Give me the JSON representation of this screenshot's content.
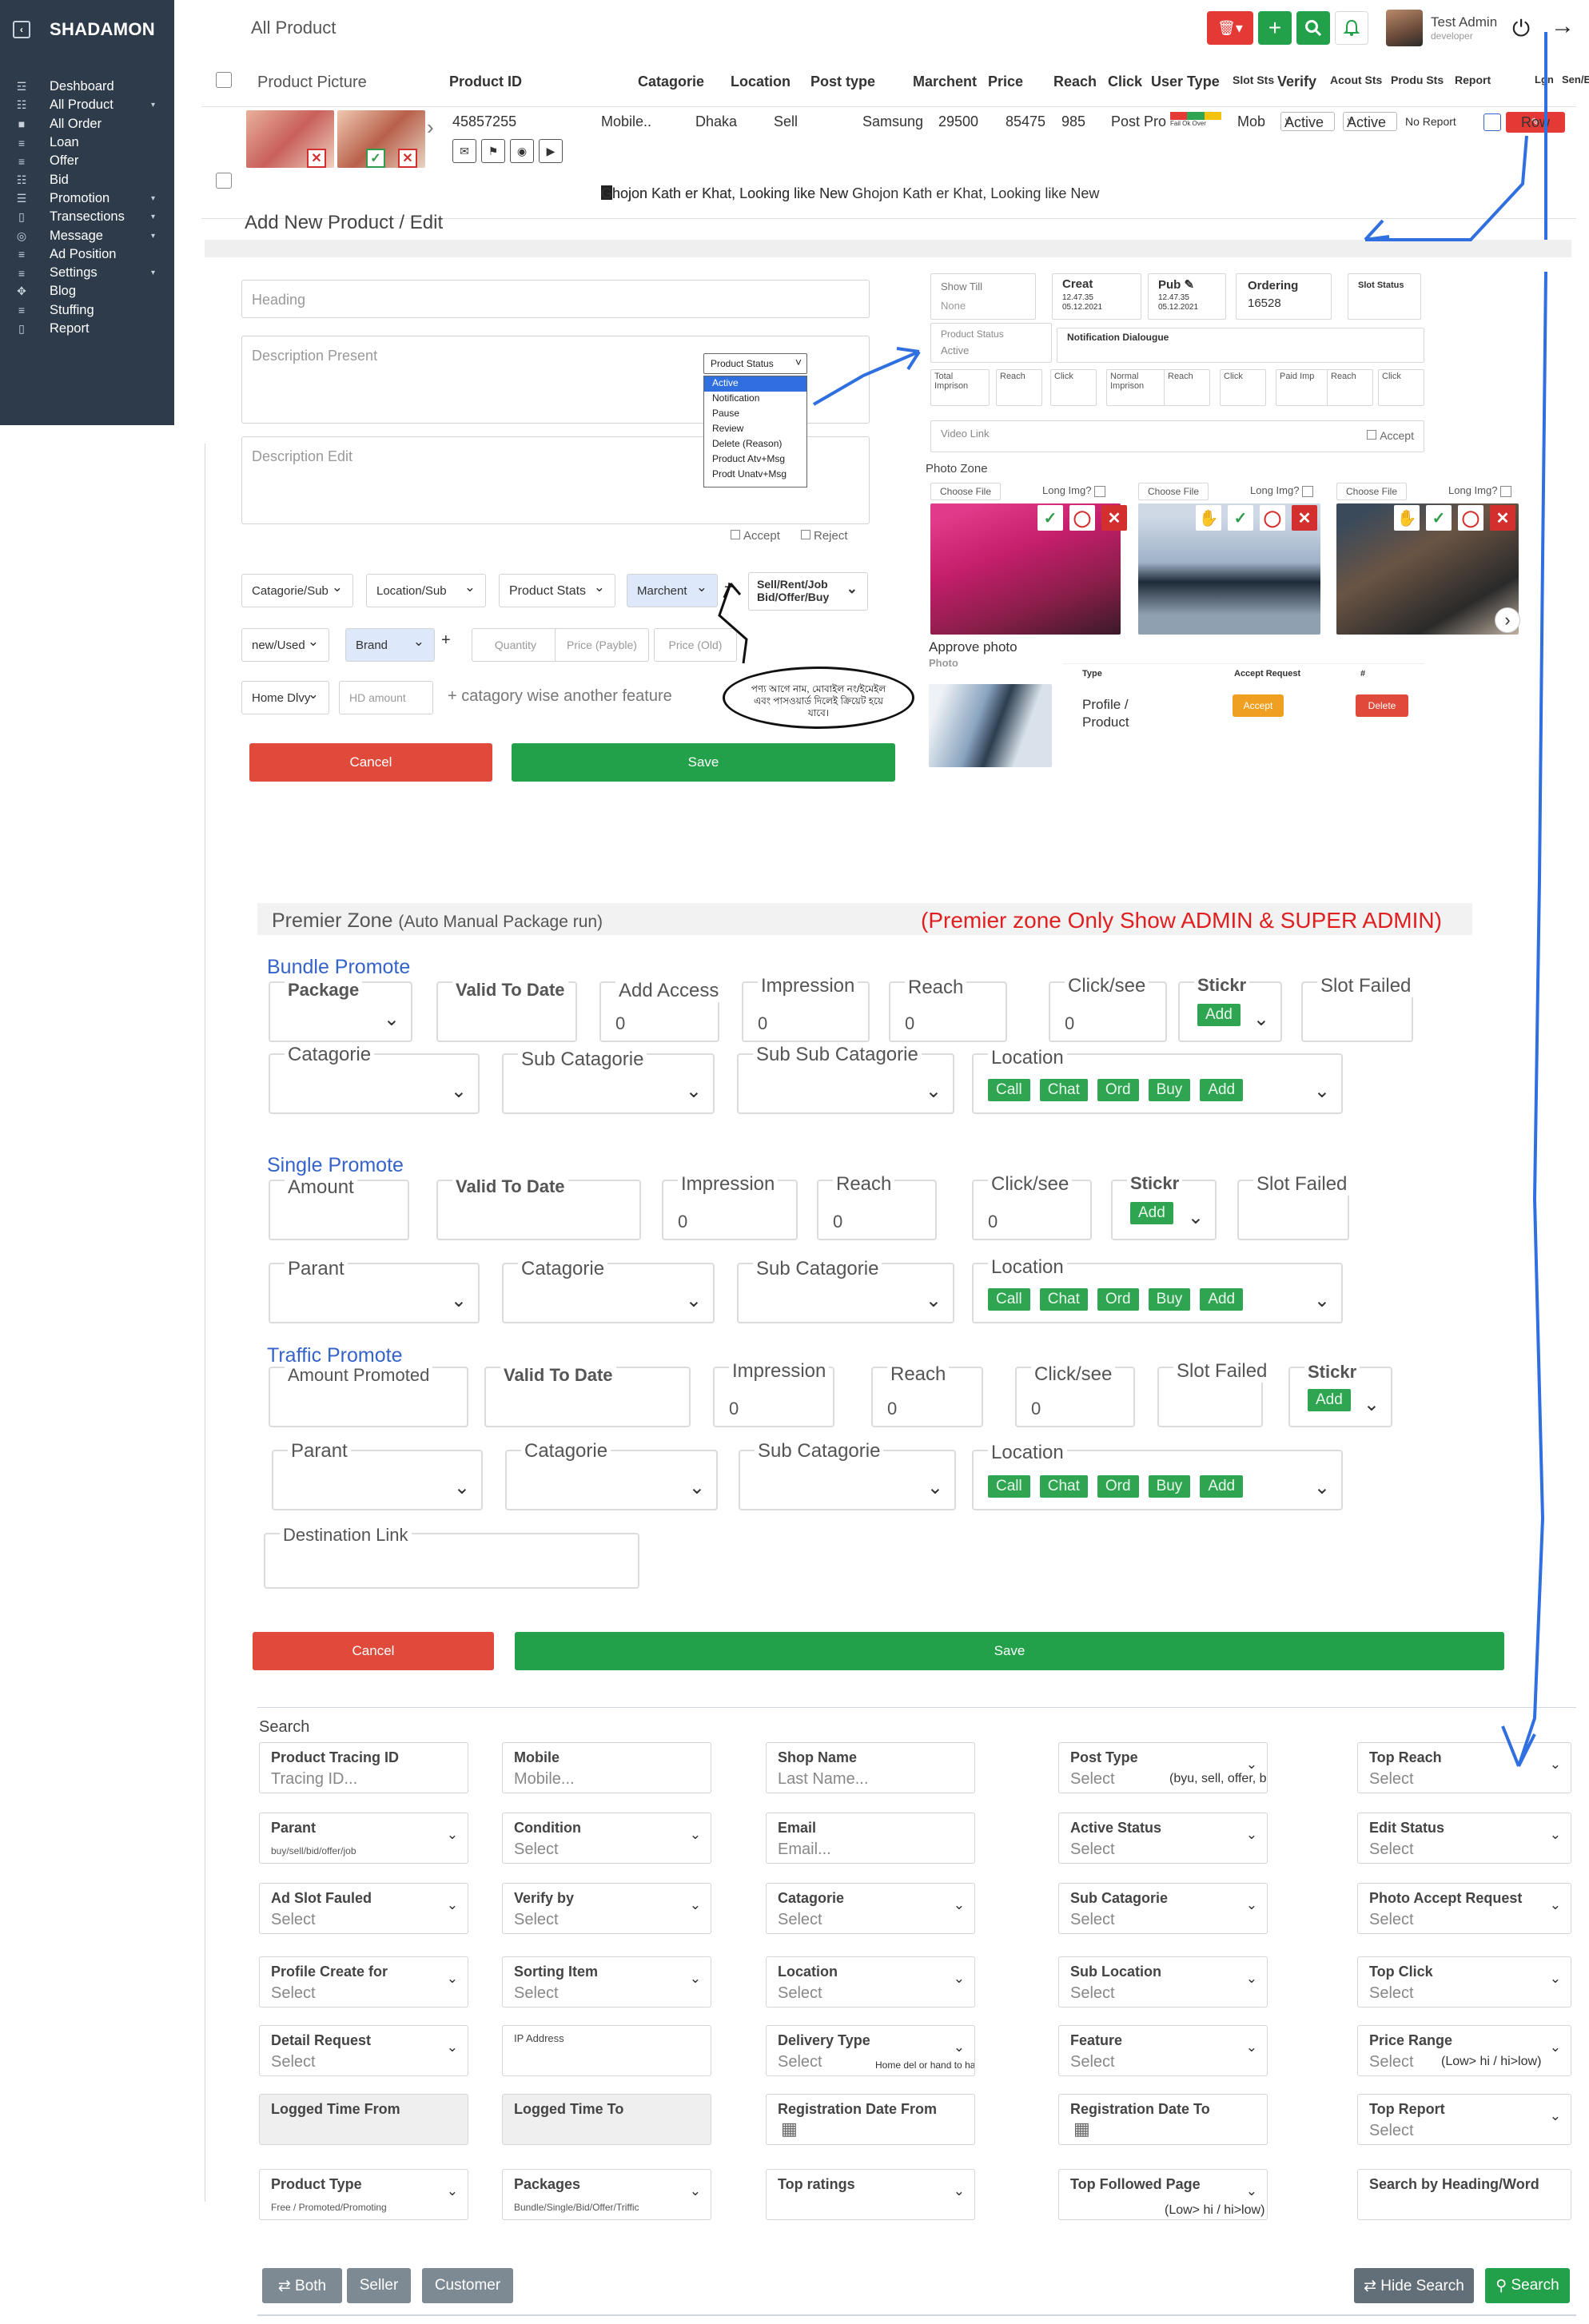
{
  "app": {
    "brand": "SHADAMON",
    "collapse_icon": "collapse-icon"
  },
  "sidebar": {
    "items": [
      {
        "label": "Deshboard",
        "icon": "dashboard-icon",
        "caret": false
      },
      {
        "label": "All Product",
        "icon": "grid-icon",
        "caret": true
      },
      {
        "label": "All Order",
        "icon": "order-icon",
        "caret": false
      },
      {
        "label": "Loan",
        "icon": "loan-icon",
        "caret": false
      },
      {
        "label": "Offer",
        "icon": "offer-icon",
        "caret": false
      },
      {
        "label": "Bid",
        "icon": "bid-icon",
        "caret": false
      },
      {
        "label": "Promotion",
        "icon": "promotion-icon",
        "caret": true
      },
      {
        "label": "Transections",
        "icon": "transactions-icon",
        "caret": true
      },
      {
        "label": "Message",
        "icon": "message-icon",
        "caret": true
      },
      {
        "label": "Ad Position",
        "icon": "position-icon",
        "caret": false
      },
      {
        "label": "Settings",
        "icon": "settings-icon",
        "caret": true
      },
      {
        "label": "Blog",
        "icon": "blog-icon",
        "caret": false
      },
      {
        "label": "Stuffing",
        "icon": "staff-icon",
        "caret": false
      },
      {
        "label": "Report",
        "icon": "report-icon",
        "caret": false
      }
    ]
  },
  "topbar": {
    "title": "All Product",
    "user_name": "Test Admin",
    "user_role": "developer"
  },
  "product_table": {
    "headers": [
      "Product Picture",
      "Product ID",
      "Catagorie",
      "Location",
      "Post type",
      "Marchent",
      "Price",
      "Reach",
      "Click",
      "User Type",
      "Slot Sts",
      "Verify",
      "Acout Sts",
      "Produ Sts",
      "Report",
      "Lgn",
      "Sen/Edi By"
    ],
    "row": {
      "product_id": "45857255",
      "catagorie": "Mobile..",
      "location": "Dhaka",
      "post_type": "Sell",
      "marchent": "Samsung",
      "price": "29500",
      "reach": "85475",
      "click": "985",
      "user_type": "Post Pro",
      "slot_legend": "Fail Ok Over",
      "verify": "Mob",
      "acout_sts": "Active",
      "produ_sts": "Active",
      "report": "No Report",
      "row_btn": "Row",
      "headline": "Ghojon Kath er Khat, Looking like New",
      "headline_2": "Ghojon Kath er Khat, Looking like New Ghojon Kath er Khat, Looking like New"
    }
  },
  "add_product": {
    "title": "Add New Product / Edit",
    "heading_ph": "Heading",
    "desc_present": "Description  Present",
    "desc_edit": "Description  Edit",
    "status_dropdown": {
      "label": "Product Status",
      "options": [
        "Active",
        "Notification",
        "Pause",
        "Review",
        "Delete (Reason)",
        "Product Atv+Msg",
        "Prodt Unatv+Msg"
      ]
    },
    "accept": "Accept",
    "reject": "Reject",
    "selects_row1": [
      "Catagorie/Sub",
      "Location/Sub",
      "Product Stats",
      "Marchent"
    ],
    "sell_options": "Sell/Rent/Job Bid/Offer/Buy",
    "selects_row2": [
      "new/Used",
      "Brand"
    ],
    "inputs_row2": [
      "Quantity",
      "Price (Payble)",
      "Price (Old)"
    ],
    "row3": [
      "Home Dlvy",
      "HD amount"
    ],
    "feature_link": "+ catagory wise another feature",
    "note_bn": "পণ্য আগে নাম, মোবাইল নং/ইমেইল এবং পাসওয়ার্ড দিলেই ক্রিয়েট হয়ে যাবে।",
    "cancel": "Cancel",
    "save": "Save",
    "right": {
      "show_till": "Show Till",
      "none": "None",
      "creat": "Creat",
      "creat_val": "12.47.35 05.12.2021",
      "pub": "Pub",
      "pub_val": "12.47.35 05.12.2021",
      "ordering": "Ordering",
      "ordering_val": "16528",
      "slot_status": "Slot Status",
      "product_status": "Product Status",
      "product_status_val": "Active",
      "notification": "Notification Dialougue",
      "stats": [
        "Total Imprison",
        "Reach",
        "Click",
        "Normal Imprison",
        "Reach",
        "Click",
        "Paid Imp",
        "Reach",
        "Click"
      ],
      "video_link": "Video Link",
      "accept": "Accept",
      "photo_zone": "Photo Zone",
      "choose_file": "Choose File",
      "long_img": "Long Img?",
      "approve_photo": "Approve photo",
      "photo": "Photo",
      "type_h": "Type",
      "accept_req_h": "Accept Request",
      "hash_h": "#",
      "type_val": "Profile / Product",
      "accept_btn": "Accept",
      "delete_btn": "Delete"
    }
  },
  "premier": {
    "title": "Premier Zone",
    "subtitle": "(Auto Manual Package run)",
    "note": "(Premier zone Only Show ADMIN & SUPER ADMIN)",
    "bundle": {
      "title": "Bundle Promote",
      "fields": [
        "Package",
        "Valid To Date",
        "Add Access",
        "Impression",
        "Reach",
        "Click/see",
        "Stickr",
        "Slot Failed"
      ],
      "row2": [
        "Catagorie",
        "Sub Catagorie",
        "Sub Sub Catagorie",
        "Location"
      ]
    },
    "single": {
      "title": "Single Promote",
      "fields": [
        "Amount",
        "Valid To Date",
        "Impression",
        "Reach",
        "Click/see",
        "Stickr",
        "Slot Failed"
      ],
      "row2": [
        "Parant",
        "Catagorie",
        "Sub Catagorie",
        "Location"
      ]
    },
    "traffic": {
      "title": "Traffic Promote",
      "fields": [
        "Amount Promoted",
        "Valid To Date",
        "Impression",
        "Reach",
        "Click/see",
        "Slot Failed",
        "Stickr"
      ],
      "row2": [
        "Parant",
        "Catagorie",
        "Sub Catagorie",
        "Location"
      ]
    },
    "zero": "0",
    "add": "Add",
    "location_chips": [
      "Call",
      "Chat",
      "Ord",
      "Buy",
      "Add"
    ],
    "destination": "Destination Link",
    "cancel": "Cancel",
    "save": "Save"
  },
  "search": {
    "title": "Search",
    "fields": [
      {
        "t": "Product Tracing ID",
        "p": "Tracing ID..."
      },
      {
        "t": "Mobile",
        "p": "Mobile..."
      },
      {
        "t": "Shop Name",
        "p": "Last Name..."
      },
      {
        "t": "Post Type",
        "p": "Select",
        "extra": "(byu, sell, offer, bid...)"
      },
      {
        "t": "Top Reach",
        "p": "Select"
      },
      {
        "t": "Parant",
        "p": "buy/sell/bid/offer/job"
      },
      {
        "t": "Condition",
        "p": "Select"
      },
      {
        "t": "Email",
        "p": "Email..."
      },
      {
        "t": "Active Status",
        "p": "Select"
      },
      {
        "t": "Edit Status",
        "p": "Select"
      },
      {
        "t": "Ad Slot Fauled",
        "p": "Select"
      },
      {
        "t": "Verify by",
        "p": "Select"
      },
      {
        "t": "Catagorie",
        "p": "Select"
      },
      {
        "t": "Sub Catagorie",
        "p": "Select"
      },
      {
        "t": "Photo Accept Request",
        "p": "Select"
      },
      {
        "t": "Profile Create for",
        "p": "Select"
      },
      {
        "t": "Sorting Item",
        "p": "Select"
      },
      {
        "t": "Location",
        "p": "Select"
      },
      {
        "t": "Sub Location",
        "p": "Select"
      },
      {
        "t": "Top Click",
        "p": "Select"
      },
      {
        "t": "Detail Request",
        "p": "Select"
      },
      {
        "t": "IP Address",
        "p": ""
      },
      {
        "t": "Delivery Type",
        "p": "Select",
        "extra": "Home del or hand to hand"
      },
      {
        "t": "Feature",
        "p": "Select"
      },
      {
        "t": "Price Range",
        "p": "Select",
        "extra": "(Low> hi / hi>low)"
      },
      {
        "t": "Logged Time From",
        "p": ""
      },
      {
        "t": "Logged Time To",
        "p": ""
      },
      {
        "t": "Registration Date From",
        "p": ""
      },
      {
        "t": "Registration Date To",
        "p": ""
      },
      {
        "t": "Top Report",
        "p": "Select"
      },
      {
        "t": "Product Type",
        "p": "Free / Promoted/Promoting"
      },
      {
        "t": "Packages",
        "p": "Bundle/Single/Bid/Offer/Triffic"
      },
      {
        "t": "Top ratings",
        "p": ""
      },
      {
        "t": "Top  Followed Page",
        "p": "",
        "extra": "(Low> hi / hi>low)"
      },
      {
        "t": "Search by Heading/Word",
        "p": ""
      }
    ],
    "buttons": {
      "both": "⇄ Both",
      "seller": "Seller",
      "customer": "Customer",
      "hide": "⇄ Hide Search",
      "search": "Search"
    }
  },
  "colors": {
    "sidebar": "#2e3b4a",
    "red": "#e04a3a",
    "green": "#22a04a",
    "blue_annotation": "#2f6fe0",
    "premier_note": "#e02020"
  }
}
